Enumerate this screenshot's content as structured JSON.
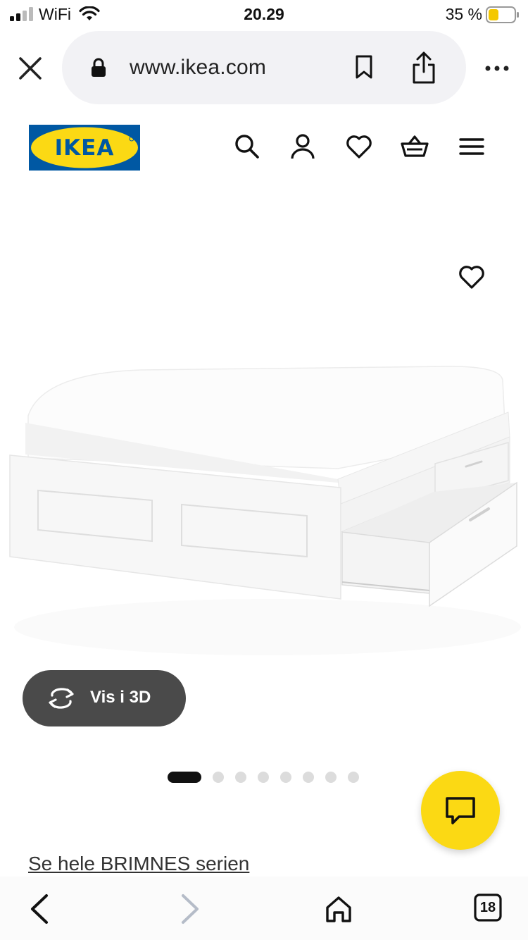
{
  "status_bar": {
    "carrier": "WiFi",
    "time": "20.29",
    "battery": "35 %"
  },
  "browser": {
    "url": "www.ikea.com",
    "tab_count": "18"
  },
  "product": {
    "view_3d_label": "Vis i 3D",
    "gallery_total": 8,
    "gallery_active": 1,
    "series_link": "Se hele BRIMNES serien"
  },
  "brand": {
    "logo_text": "IKEA",
    "blue": "#0058a3",
    "yellow": "#fbd914"
  },
  "icons": {
    "header": [
      "search-icon",
      "account-icon",
      "heart-icon",
      "basket-icon",
      "menu-icon"
    ],
    "toolbar": [
      "back-icon",
      "forward-icon",
      "home-icon",
      "tabs-icon"
    ]
  }
}
